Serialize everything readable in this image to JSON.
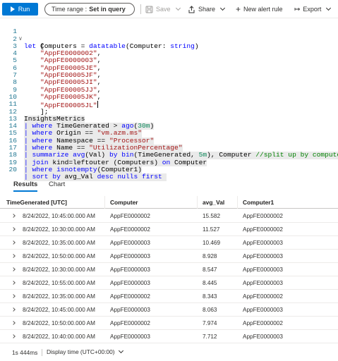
{
  "toolbar": {
    "run_label": "Run",
    "time_range_label": "Time range :",
    "time_range_value": "Set in query",
    "save_label": "Save",
    "share_label": "Share",
    "new_alert_label": "New alert rule",
    "export_label": "Export"
  },
  "editor": {
    "lines": [
      {
        "n": "1",
        "text": "let Computers = datatable(Computer: string)"
      },
      {
        "n": "2",
        "text": "["
      },
      {
        "n": "3",
        "text": "\"AppFE0000002\","
      },
      {
        "n": "4",
        "text": "\"AppFE0000003\","
      },
      {
        "n": "5",
        "text": "\"AppFE00005JE\","
      },
      {
        "n": "6",
        "text": "\"AppFE00005JF\","
      },
      {
        "n": "7",
        "text": "\"AppFE00005JI\","
      },
      {
        "n": "8",
        "text": "\"AppFE00005JJ\","
      },
      {
        "n": "9",
        "text": "\"AppFE00005JK\","
      },
      {
        "n": "10",
        "text": "\"AppFE00005JL\""
      },
      {
        "n": "11",
        "text": "];"
      },
      {
        "n": "12",
        "text": "InsightsMetrics"
      },
      {
        "n": "13",
        "text": "| where TimeGenerated > ago(30m)"
      },
      {
        "n": "14",
        "text": "| where Origin == \"vm.azm.ms\""
      },
      {
        "n": "15",
        "text": "| where Namespace == \"Processor\""
      },
      {
        "n": "16",
        "text": "| where Name == \"UtilizationPercentage\""
      },
      {
        "n": "17",
        "text": "| summarize avg(Val) by bin(TimeGenerated, 5m), Computer //split up by computer"
      },
      {
        "n": "18",
        "text": "| join kind=leftouter (Computers) on Computer"
      },
      {
        "n": "19",
        "text": "| where isnotempty(Computer1)"
      },
      {
        "n": "20",
        "text": "| sort by avg_Val desc nulls first"
      }
    ]
  },
  "tabs": [
    {
      "label": "Results",
      "active": true
    },
    {
      "label": "Chart",
      "active": false
    }
  ],
  "table": {
    "columns": [
      "TimeGenerated [UTC]",
      "Computer",
      "avg_Val",
      "Computer1"
    ],
    "rows": [
      [
        "8/24/2022, 10:45:00.000 AM",
        "AppFE0000002",
        "15.582",
        "AppFE0000002"
      ],
      [
        "8/24/2022, 10:30:00.000 AM",
        "AppFE0000002",
        "11.527",
        "AppFE0000002"
      ],
      [
        "8/24/2022, 10:35:00.000 AM",
        "AppFE0000003",
        "10.469",
        "AppFE0000003"
      ],
      [
        "8/24/2022, 10:50:00.000 AM",
        "AppFE0000003",
        "8.928",
        "AppFE0000003"
      ],
      [
        "8/24/2022, 10:30:00.000 AM",
        "AppFE0000003",
        "8.547",
        "AppFE0000003"
      ],
      [
        "8/24/2022, 10:55:00.000 AM",
        "AppFE0000003",
        "8.445",
        "AppFE0000003"
      ],
      [
        "8/24/2022, 10:35:00.000 AM",
        "AppFE0000002",
        "8.343",
        "AppFE0000002"
      ],
      [
        "8/24/2022, 10:45:00.000 AM",
        "AppFE0000003",
        "8.063",
        "AppFE0000003"
      ],
      [
        "8/24/2022, 10:50:00.000 AM",
        "AppFE0000002",
        "7.974",
        "AppFE0000002"
      ],
      [
        "8/24/2022, 10:40:00.000 AM",
        "AppFE0000003",
        "7.712",
        "AppFE0000003"
      ]
    ]
  },
  "status": {
    "duration": "1s 444ms",
    "display_time": "Display time (UTC+00:00)"
  },
  "colors": {
    "accent": "#0078d4",
    "keyword": "#0000ff",
    "string": "#a31515",
    "number": "#098658",
    "comment": "#008000",
    "line_number": "#237893"
  },
  "icons": {
    "run": "play-icon",
    "save": "save-icon",
    "share": "share-icon",
    "new_alert": "plus-icon",
    "export": "export-icon"
  }
}
